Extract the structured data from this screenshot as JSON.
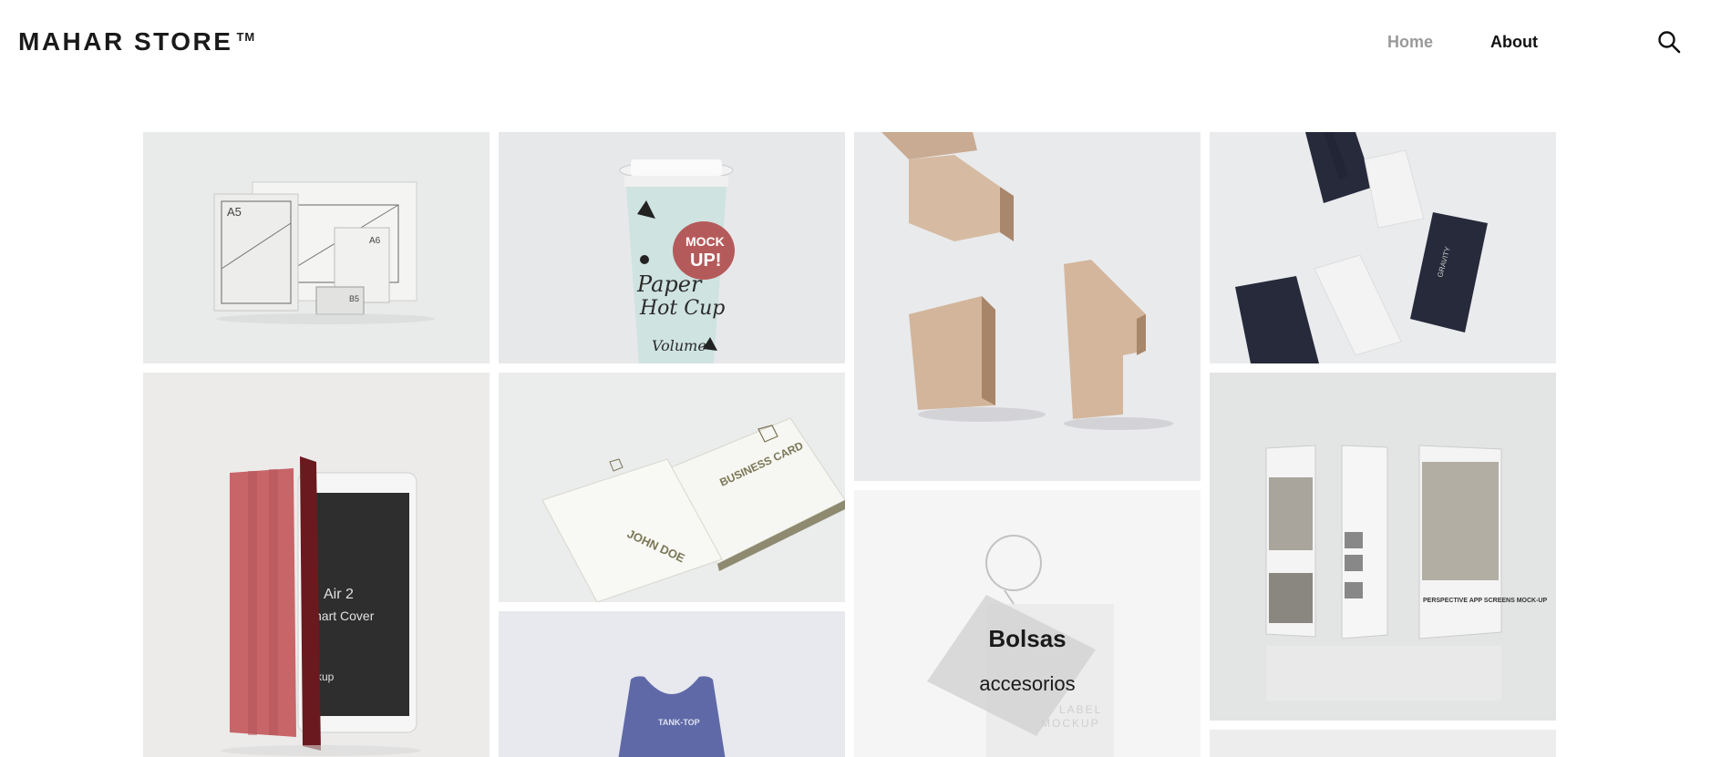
{
  "header": {
    "logo": "MAHAR STORE",
    "logo_tm": "TM",
    "nav": {
      "home": "Home",
      "about": "About"
    },
    "search_icon": "search-icon",
    "nav_active_color": "#9a9a9a"
  },
  "gallery": {
    "items": [
      {
        "name": "stationery-mockup",
        "labels": {
          "a5": "A5",
          "a6": "A6",
          "b5": "B5"
        }
      },
      {
        "name": "paper-cup-mockup",
        "labels": {
          "mock": "MOCK",
          "up": "UP!",
          "paper": "Paper",
          "hotcup": "Hot Cup",
          "volume": "Volume"
        }
      },
      {
        "name": "wooden-blocks"
      },
      {
        "name": "gravity-business-cards",
        "labels": {
          "brand": "GRAVITY"
        }
      },
      {
        "name": "ipad-smart-cover",
        "labels": {
          "air": "Air 2",
          "cover": "nart Cover",
          "uk": "kup"
        }
      },
      {
        "name": "business-card-john-doe",
        "labels": {
          "title": "BUSINESS CARD",
          "person": "JOHN DOE"
        }
      },
      {
        "name": "bolsas-category",
        "title": "Bolsas",
        "subtitle": "accesorios",
        "labels": {
          "tag1": "LABEL",
          "tag2": "MOCKUP"
        }
      },
      {
        "name": "app-screens-mockup",
        "labels": {
          "screen": "PERSPECTIVE APP SCREENS MOCK-UP"
        }
      },
      {
        "name": "tank-top-mockup",
        "labels": {
          "tank": "TANK-TOP"
        }
      },
      {
        "name": "partial-tile"
      }
    ]
  }
}
